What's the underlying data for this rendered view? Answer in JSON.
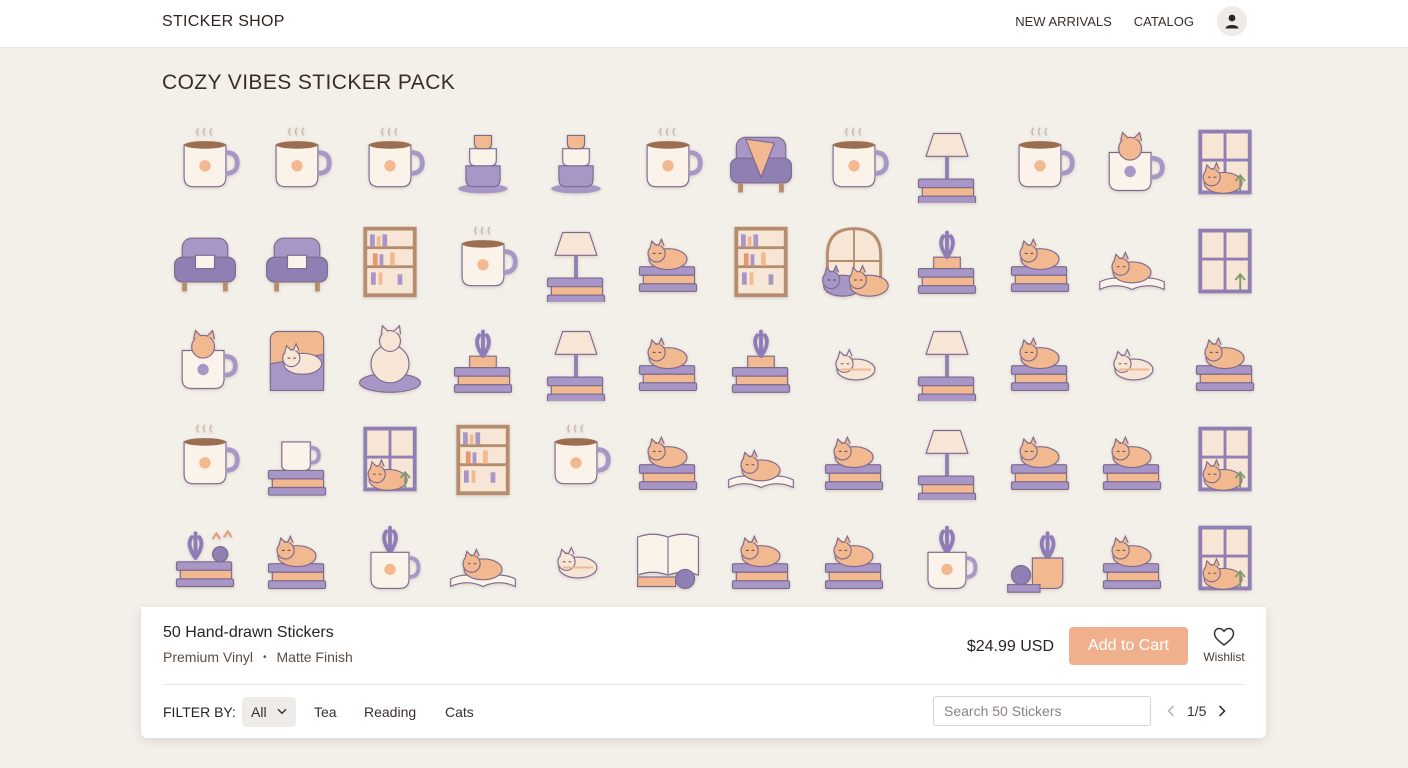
{
  "header": {
    "brand": "STICKER SHOP",
    "nav": [
      "NEW ARRIVALS",
      "CATALOG"
    ]
  },
  "page_title": "COZY VIBES STICKER PACK",
  "stickers": [
    [
      "mug-icon",
      "mug-icon",
      "mug-icon",
      "stacked-cups-icon",
      "stacked-cups-icon",
      "mug-icon",
      "armchair-blanket-icon",
      "mug-icon",
      "lamp-icon",
      "mug-icon",
      "cat-mug-icon",
      "window-cat-icon"
    ],
    [
      "armchair-icon",
      "armchair-icon",
      "bookshelf-icon",
      "mug-icon",
      "lamp-icon",
      "cat-books-icon",
      "bookshelf-icon",
      "window-cats-icon",
      "plant-books-icon",
      "cat-books-icon",
      "cat-book-icon",
      "window-icon"
    ],
    [
      "cat-mug-icon",
      "cat-blanket-icon",
      "cat-rug-icon",
      "plant-books-icon",
      "lamp-icon",
      "cat-books-icon",
      "plant-books-icon",
      "cat-icon",
      "lamp-icon",
      "cat-books-icon",
      "cat-icon",
      "cat-books-icon"
    ],
    [
      "mug-icon",
      "mug-books-icon",
      "window-cat-icon",
      "bookshelf-icon",
      "mug-icon",
      "cat-books-icon",
      "cat-book-icon",
      "cat-books-icon",
      "lamp-icon",
      "cat-books-icon",
      "cat-books-icon",
      "window-cat-icon"
    ],
    [
      "books-yarn-icon",
      "cat-books-icon",
      "plant-mug-icon",
      "cat-book-icon",
      "cat-icon",
      "book-yarn-icon",
      "cat-books-icon",
      "cat-books-icon",
      "plant-mug-icon",
      "plant-yarn-icon",
      "cat-books-icon",
      "window-cat-icon"
    ]
  ],
  "product": {
    "name": "50 Hand-drawn Stickers",
    "material": "Premium Vinyl",
    "separator": "•",
    "finish": "Matte Finish",
    "price": "$24.99 USD",
    "add_to_cart": "Add to Cart",
    "wishlist": "Wishlist"
  },
  "filters": {
    "label": "FILTER BY:",
    "selected": "All",
    "options": [
      "Tea",
      "Reading",
      "Cats"
    ]
  },
  "search": {
    "placeholder": "Search 50 Stickers"
  },
  "pagination": {
    "current": "1/5"
  },
  "colors": {
    "accent": "#f0b08d",
    "lavender": "#a796c6",
    "peach": "#f2b88f",
    "background": "#f3efe9"
  }
}
